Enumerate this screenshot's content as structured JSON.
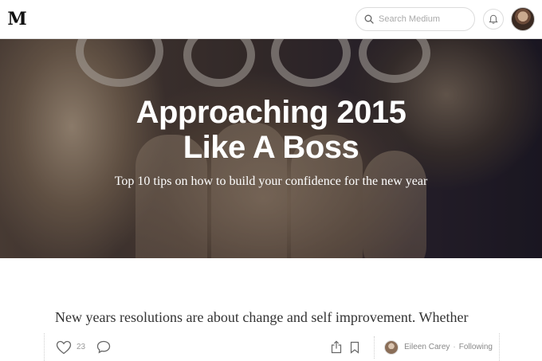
{
  "topbar": {
    "logo": "M",
    "search_placeholder": "Search Medium"
  },
  "hero": {
    "title_line1": "Approaching 2015",
    "title_line2": "Like A Boss",
    "subtitle": "Top 10 tips on how to build your confidence for the new year"
  },
  "article": {
    "lead": "New years resolutions are about change and self improvement. Whether"
  },
  "actions": {
    "recommend_count": "23",
    "author_name": "Eileen Carey",
    "separator": "·",
    "follow_label": "Following"
  },
  "colors": {
    "text": "#333333",
    "muted": "#999999",
    "border": "#e6e6e6"
  }
}
